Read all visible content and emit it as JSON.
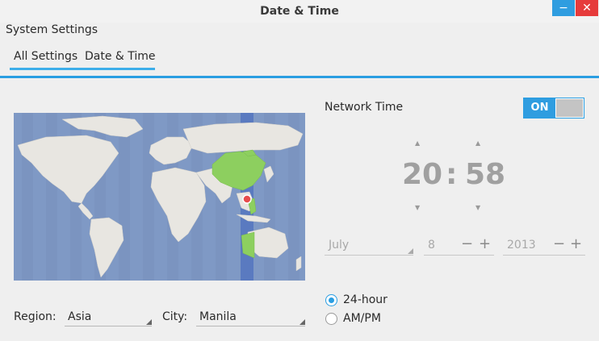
{
  "window": {
    "title": "Date & Time",
    "minimize_glyph": "−",
    "close_glyph": "✕"
  },
  "breadcrumb": {
    "root": "System Settings",
    "tabs": [
      {
        "label": "All Settings"
      },
      {
        "label": "Date & Time"
      }
    ]
  },
  "location": {
    "region_label": "Region:",
    "region_value": "Asia",
    "city_label": "City:",
    "city_value": "Manila",
    "map_icon": "world-map"
  },
  "network_time": {
    "label": "Network Time",
    "toggle_state": "ON"
  },
  "clock": {
    "hours": "20",
    "separator": ":",
    "minutes": "58",
    "up_arrow": "▲",
    "down_arrow": "▼"
  },
  "date": {
    "month": "July",
    "day": "8",
    "year": "2013",
    "minus": "−",
    "plus": "+"
  },
  "format": {
    "options": [
      {
        "label": "24-hour",
        "selected": true
      },
      {
        "label": "AM/PM",
        "selected": false
      }
    ]
  },
  "colors": {
    "accent": "#2a9ee2",
    "close": "#e63b3b",
    "map_ocean": "#7f99c5",
    "map_land": "#e8e6e1",
    "timezone_highlight": "#8dcf5f"
  }
}
